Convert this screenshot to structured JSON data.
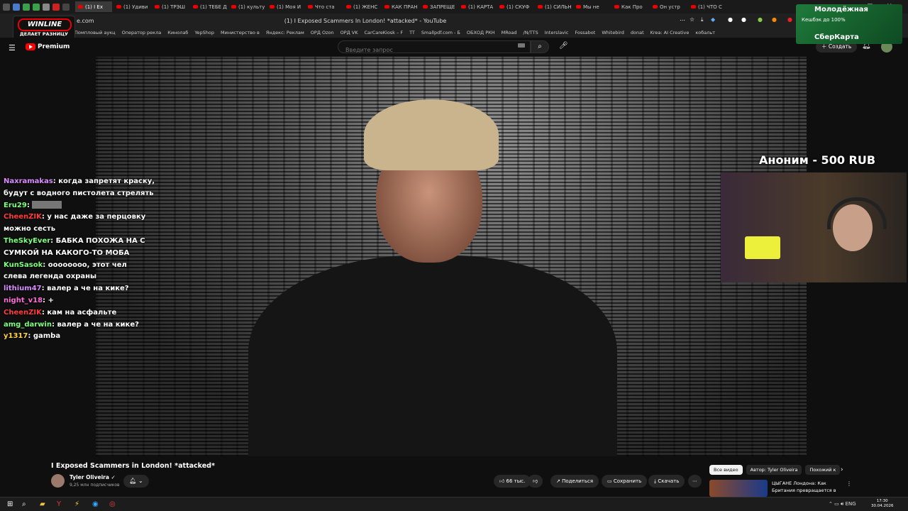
{
  "browser": {
    "tabs": [
      {
        "label": "(1) I Ex",
        "active": true
      },
      {
        "label": "(1) Удиви"
      },
      {
        "label": "(1) ТРЭШ"
      },
      {
        "label": "(1) ТЕБЕ Д"
      },
      {
        "label": "(1) культу"
      },
      {
        "label": "(1) Моя И"
      },
      {
        "label": "Что ста"
      },
      {
        "label": "(1) ЖЕНС"
      },
      {
        "label": "КАК ПРАН"
      },
      {
        "label": "ЗАПРЕЩЕ"
      },
      {
        "label": "(1) КАРТА"
      },
      {
        "label": "(1) СКУФ"
      },
      {
        "label": "(1) СИЛЬН"
      },
      {
        "label": "Мы не"
      },
      {
        "label": "Как Про"
      },
      {
        "label": "Он устр"
      },
      {
        "label": "(1) ЧТО С"
      }
    ],
    "url": "e.com",
    "window_title": "(1) I Exposed Scammers In London! *attacked* - YouTube",
    "bookmarks": [
      "Помпловый аукц",
      "Оператор рекла",
      "Кинолаб",
      "YepShop",
      "Министерство в",
      "Яндекс: Реклам",
      "ОРД Ozon",
      "ОРД VK",
      "CarCareKiosk – F",
      "TT",
      "Smallpdf.com - Б",
      "ОБХОД РКН",
      "MRoad",
      "/N/TTS",
      "Interslavic",
      "Fossabot",
      "Whitebird",
      "donat",
      "Krea: AI Creative",
      "кобальт"
    ]
  },
  "sponsor": {
    "name": "WINLINE",
    "slogan": "ДЕЛАЕТ РАЗНИЦУ"
  },
  "youtube": {
    "logo_label": "Premium",
    "search_placeholder": "Введите запрос",
    "create_label": "Создать"
  },
  "ad_banner": {
    "line1": "Молодёжная",
    "line2": "Кешбэк до 100%",
    "line3": "СберКарта"
  },
  "donation": {
    "text": "Аноним - 500 RUB"
  },
  "chat": [
    {
      "user": "Naxramakas",
      "color": "#d98cff",
      "text": "когда запретят краску,"
    },
    {
      "user": "",
      "color": "#ffffff",
      "text": "будут с водного пистолета стрелять"
    },
    {
      "user": "Eru29",
      "color": "#7cff7c",
      "text": "",
      "thumb": true
    },
    {
      "user": "CheenZIK",
      "color": "#ff3b3b",
      "text": "у нас даже за перцовку"
    },
    {
      "user": "",
      "color": "#ffffff",
      "text": "можно сесть"
    },
    {
      "user": "TheSkyEver",
      "color": "#7cff7c",
      "text": "БАБКА ПОХОЖА НА С"
    },
    {
      "user": "",
      "color": "#ffffff",
      "text": "СУМКОЙ НА КАКОГО-ТО МОБА"
    },
    {
      "user": "KunSasok",
      "color": "#7cff7c",
      "text": "оооооооо, этот чел"
    },
    {
      "user": "",
      "color": "#ffffff",
      "text": "слева легенда охраны"
    },
    {
      "user": "lithium47",
      "color": "#d98cff",
      "text": "валер а че на кике?"
    },
    {
      "user": "night_v18",
      "color": "#ff6bd6",
      "text": "+"
    },
    {
      "user": "CheenZIK",
      "color": "#ff3b3b",
      "text": "кам на асфальте"
    },
    {
      "user": "amg_darwin",
      "color": "#7cff7c",
      "text": "валер а че на кике?"
    },
    {
      "user": "y1317",
      "color": "#ffd23f",
      "text": "gamba"
    }
  ],
  "video": {
    "title": "I Exposed Scammers in London! *attacked*",
    "channel": "Tyler Oliveira",
    "subscribers": "9,25 млн подписчиков",
    "likes": "66 тыс.",
    "share_label": "Поделиться",
    "save_label": "Сохранить",
    "download_label": "Скачать"
  },
  "filter_chips": [
    "Все видео",
    "Автор: Tyler Oliveira",
    "Похожий к"
  ],
  "recommended": {
    "title": "ЦЫГАНЕ Лондона: Как Британия превращается в ..."
  },
  "taskbar": {
    "lang": "ENG",
    "time": "17:30",
    "date": "30.04.2026"
  }
}
